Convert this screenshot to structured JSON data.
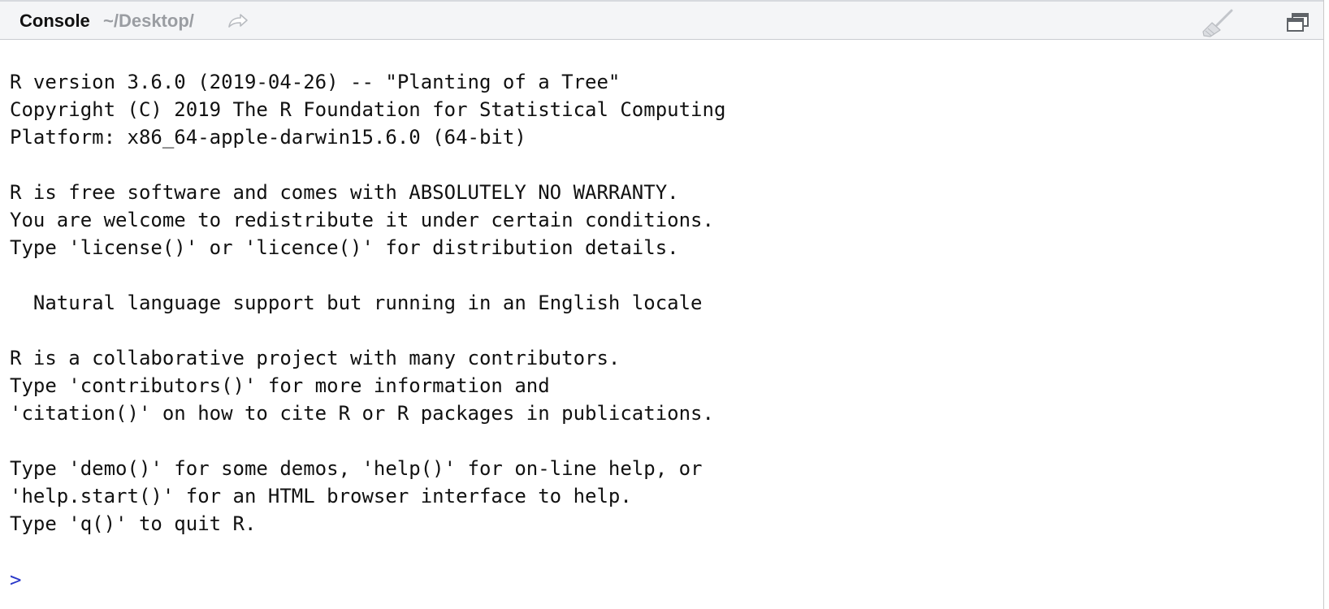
{
  "header": {
    "title": "Console",
    "path": "~/Desktop/",
    "icons": {
      "goto": "goto-directory-icon",
      "clear": "broom-icon",
      "maximize": "maximize-icon"
    }
  },
  "colors": {
    "header_bg": "#f4f5f7",
    "text": "#111111",
    "path": "#9a9da2",
    "prompt": "#2a38c9"
  },
  "console": {
    "lines": [
      "R version 3.6.0 (2019-04-26) -- \"Planting of a Tree\"",
      "Copyright (C) 2019 The R Foundation for Statistical Computing",
      "Platform: x86_64-apple-darwin15.6.0 (64-bit)",
      "",
      "R is free software and comes with ABSOLUTELY NO WARRANTY.",
      "You are welcome to redistribute it under certain conditions.",
      "Type 'license()' or 'licence()' for distribution details.",
      "",
      "  Natural language support but running in an English locale",
      "",
      "R is a collaborative project with many contributors.",
      "Type 'contributors()' for more information and",
      "'citation()' on how to cite R or R packages in publications.",
      "",
      "Type 'demo()' for some demos, 'help()' for on-line help, or",
      "'help.start()' for an HTML browser interface to help.",
      "Type 'q()' to quit R."
    ],
    "prompt": ">"
  }
}
